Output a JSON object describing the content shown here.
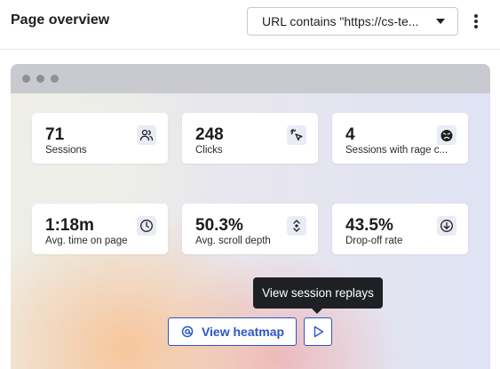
{
  "header": {
    "title": "Page overview",
    "filter_value": "URL contains \"https://cs-te..."
  },
  "metrics": [
    {
      "value": "71",
      "label": "Sessions",
      "icon": "users-icon"
    },
    {
      "value": "248",
      "label": "Clicks",
      "icon": "cursor-click-icon"
    },
    {
      "value": "4",
      "label": "Sessions with rage c...",
      "icon": "angry-face-icon"
    },
    {
      "value": "1:18m",
      "label": "Avg. time on page",
      "icon": "clock-icon"
    },
    {
      "value": "50.3%",
      "label": "Avg. scroll depth",
      "icon": "scroll-icon"
    },
    {
      "value": "43.5%",
      "label": "Drop-off rate",
      "icon": "arrow-down-circle-icon"
    }
  ],
  "actions": {
    "heatmap_label": "View heatmap",
    "replay_tooltip": "View session replays"
  },
  "colors": {
    "accent": "#2c55c9",
    "icon_bg": "#e9ecf5",
    "tooltip_bg": "#1f2024"
  }
}
